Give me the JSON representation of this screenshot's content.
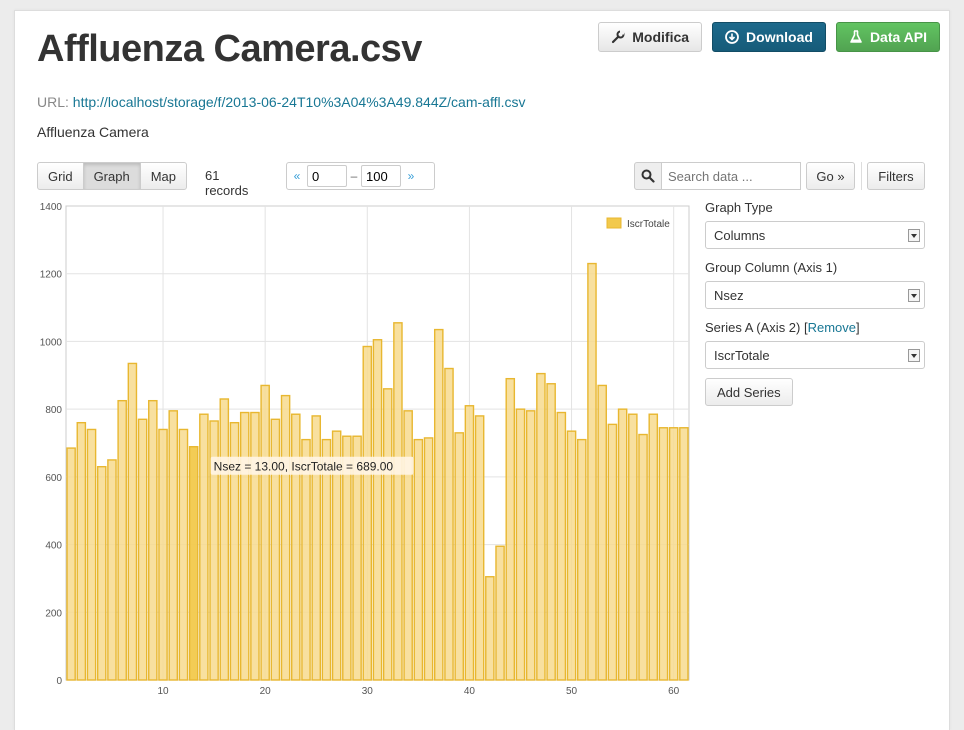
{
  "resource": {
    "title": "Affluenza Camera.csv",
    "url_label": "URL:",
    "url": "http://localhost/storage/f/2013-06-24T10%3A04%3A49.844Z/cam-affl.csv",
    "description": "Affluenza Camera"
  },
  "actions": {
    "edit_label": "Modifica",
    "download_label": "Download",
    "api_label": "Data API",
    "edit_icon": "wrench-icon",
    "download_icon": "download-circle-icon",
    "api_icon": "flask-icon"
  },
  "toolbar": {
    "views": [
      "Grid",
      "Graph",
      "Map"
    ],
    "active_view": "Graph",
    "records": "61 records",
    "pager_prev": "«",
    "pager_next": "»",
    "pager_from": "0",
    "pager_sep": "–",
    "pager_to": "100",
    "search_placeholder": "Search data ...",
    "go_label": "Go »",
    "filters_label": "Filters"
  },
  "graph_editor": {
    "graph_type_label": "Graph Type",
    "graph_type_value": "Columns",
    "group_column_label": "Group Column (Axis 1)",
    "group_column_value": "Nsez",
    "series_label": "Series A (Axis 2)",
    "series_remove_open": " [",
    "series_remove": "Remove",
    "series_remove_close": "]",
    "series_value": "IscrTotale",
    "add_series_label": "Add Series"
  },
  "chart_data": {
    "type": "bar",
    "x": [
      1,
      2,
      3,
      4,
      5,
      6,
      7,
      8,
      9,
      10,
      11,
      12,
      13,
      14,
      15,
      16,
      17,
      18,
      19,
      20,
      21,
      22,
      23,
      24,
      25,
      26,
      27,
      28,
      29,
      30,
      31,
      32,
      33,
      34,
      35,
      36,
      37,
      38,
      39,
      40,
      41,
      42,
      43,
      44,
      45,
      46,
      47,
      48,
      49,
      50,
      51,
      52,
      53,
      54,
      55,
      56,
      57,
      58,
      59,
      60,
      61
    ],
    "series": [
      {
        "name": "IscrTotale",
        "color": "#f2c94c",
        "values": [
          685,
          760,
          740,
          630,
          650,
          825,
          935,
          770,
          825,
          740,
          795,
          740,
          689,
          785,
          765,
          830,
          760,
          790,
          790,
          870,
          770,
          840,
          785,
          710,
          780,
          710,
          735,
          720,
          720,
          985,
          1005,
          860,
          1055,
          795,
          710,
          715,
          1035,
          920,
          730,
          810,
          780,
          305,
          395,
          890,
          800,
          795,
          905,
          875,
          790,
          735,
          710,
          1230,
          870,
          755,
          800,
          785,
          725,
          785,
          745,
          745,
          745
        ]
      }
    ],
    "xticks": [
      10,
      20,
      30,
      40,
      50,
      60
    ],
    "yticks": [
      0,
      200,
      400,
      600,
      800,
      1000,
      1200,
      1400
    ],
    "ylim": [
      0,
      1400
    ],
    "grid": true,
    "legend_position": "top-right",
    "tooltip": "Nsez = 13.00, IscrTotale = 689.00",
    "tooltip_index": 12
  }
}
